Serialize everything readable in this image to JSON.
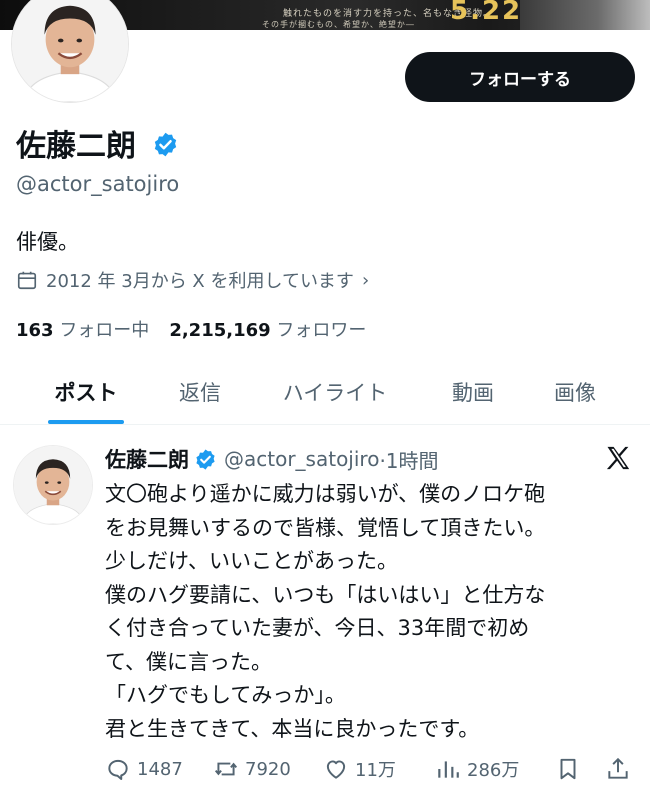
{
  "banner": {
    "tagline1": "触れたものを消す力を持った、名もなき怪物。",
    "tagline2": "その手が摑むもの、希望か、絶望か―",
    "date": "5.22"
  },
  "profile": {
    "display_name": "佐藤二朗",
    "handle": "@actor_satojiro",
    "bio": "俳優。",
    "joined": "2012 年 3月から X を利用しています",
    "following_count": "163",
    "following_label": "フォロー中",
    "followers_count": "2,215,169",
    "followers_label": "フォロワー",
    "follow_button": "フォローする"
  },
  "tabs": [
    {
      "label": "ポスト",
      "active": true
    },
    {
      "label": "返信",
      "active": false
    },
    {
      "label": "ハイライト",
      "active": false
    },
    {
      "label": "動画",
      "active": false
    },
    {
      "label": "画像",
      "active": false
    }
  ],
  "post": {
    "author": "佐藤二朗",
    "handle": "@actor_satojiro",
    "time": "·1時間",
    "lines": [
      "文〇砲より遥かに威力は弱いが、僕のノロケ砲",
      "をお見舞いするので皆様、覚悟して頂きたい。",
      "少しだけ、いいことがあった。",
      "僕のハグ要請に、いつも「はいはい」と仕方な",
      "く付き合っていた妻が、今日、33年間で初め",
      "て、僕に言った。",
      "「ハグでもしてみっか」。",
      "君と生きてきて、本当に良かったです。"
    ],
    "replies": "1487",
    "reposts": "7920",
    "likes": "11万",
    "views": "286万"
  },
  "colors": {
    "accent": "#1d9bf0",
    "text": "#0f1419",
    "secondary": "#536471",
    "button": "#0f1419"
  },
  "icons": [
    "verified-badge-icon",
    "calendar-icon",
    "chevron-right-icon",
    "x-logo-icon",
    "reply-icon",
    "repost-icon",
    "like-icon",
    "views-icon",
    "bookmark-icon",
    "share-icon"
  ]
}
